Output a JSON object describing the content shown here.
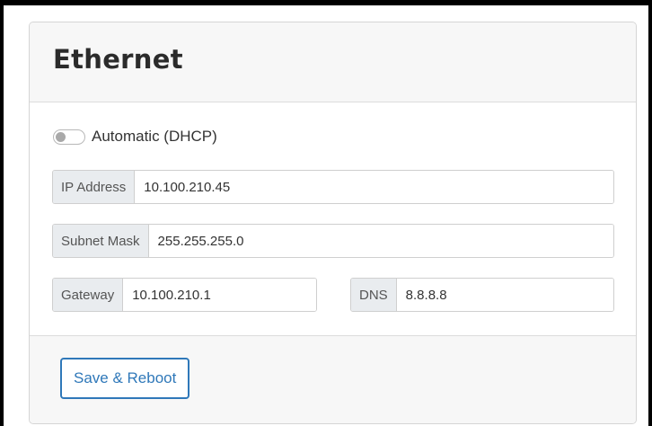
{
  "card": {
    "title": "Ethernet"
  },
  "dhcp": {
    "label": "Automatic (DHCP)",
    "enabled": false
  },
  "fields": {
    "ip_address": {
      "label": "IP Address",
      "value": "10.100.210.45"
    },
    "subnet_mask": {
      "label": "Subnet Mask",
      "value": "255.255.255.0"
    },
    "gateway": {
      "label": "Gateway",
      "value": "10.100.210.1"
    },
    "dns": {
      "label": "DNS",
      "value": "8.8.8.8"
    }
  },
  "footer": {
    "save_label": "Save & Reboot"
  },
  "colors": {
    "accent": "#2f78b9",
    "addon_bg": "#e9ecef",
    "panel_bg": "#f7f7f7"
  }
}
